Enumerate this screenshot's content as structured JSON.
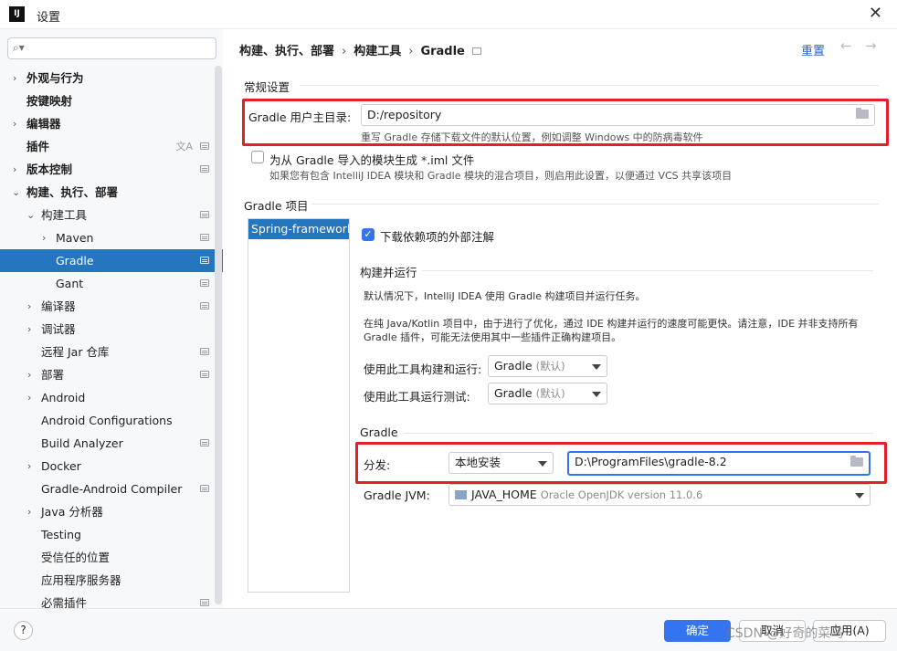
{
  "window": {
    "title": "设置",
    "app_icon": "IJ"
  },
  "search": {
    "placeholder": ""
  },
  "sidebar": {
    "items": [
      {
        "label": "外观与行为"
      },
      {
        "label": "按键映射"
      },
      {
        "label": "编辑器"
      },
      {
        "label": "插件"
      },
      {
        "label": "版本控制"
      },
      {
        "label": "构建、执行、部署"
      },
      {
        "label": "构建工具"
      },
      {
        "label": "Maven"
      },
      {
        "label": "Gradle"
      },
      {
        "label": "Gant"
      },
      {
        "label": "编译器"
      },
      {
        "label": "调试器"
      },
      {
        "label": "远程 Jar 仓库"
      },
      {
        "label": "部署"
      },
      {
        "label": "Android"
      },
      {
        "label": "Android Configurations"
      },
      {
        "label": "Build Analyzer"
      },
      {
        "label": "Docker"
      },
      {
        "label": "Gradle-Android Compiler"
      },
      {
        "label": "Java 分析器"
      },
      {
        "label": "Testing"
      },
      {
        "label": "受信任的位置"
      },
      {
        "label": "应用程序服务器"
      },
      {
        "label": "必需插件"
      }
    ],
    "selected": "Gradle"
  },
  "breadcrumb": {
    "part1": "构建、执行、部署",
    "part2": "构建工具",
    "part3": "Gradle",
    "sep": "›"
  },
  "header": {
    "reset": "重置",
    "back": "←",
    "forward": "→"
  },
  "general": {
    "title": "常规设置",
    "user_home_label": "Gradle 用户主目录:",
    "user_home_value": "D:/repository",
    "user_home_hint": "重写 Gradle 存储下载文件的默认位置，例如调整 Windows 中的防病毒软件",
    "iml_label": "为从 Gradle 导入的模块生成 *.iml 文件",
    "iml_hint": "如果您有包含 IntelliJ IDEA 模块和 Gradle 模块的混合项目，则启用此设置，以便通过 VCS 共享该项目"
  },
  "projects": {
    "title": "Gradle 项目",
    "list": [
      "Spring-framework"
    ],
    "download_annotations": "下载依赖项的外部注解",
    "build_run_title": "构建并运行",
    "desc1": "默认情况下，IntelliJ IDEA 使用 Gradle 构建项目并运行任务。",
    "desc2": "在纯 Java/Kotlin 项目中，由于进行了优化，通过 IDE 构建并运行的速度可能更快。请注意，IDE 并非支持所有",
    "desc3": "Gradle 插件，可能无法使用其中一些插件正确构建项目。",
    "build_with_label": "使用此工具构建和运行:",
    "build_with_value": "Gradle",
    "build_with_suffix": "(默认)",
    "test_with_label": "使用此工具运行测试:",
    "test_with_value": "Gradle",
    "test_with_suffix": "(默认)",
    "gradle_title": "Gradle",
    "dist_label": "分发:",
    "dist_value": "本地安装",
    "dist_path": "D:\\ProgramFiles\\gradle-8.2",
    "jvm_label": "Gradle JVM:",
    "jvm_value": "JAVA_HOME",
    "jvm_detail": "Oracle OpenJDK version 11.0.6"
  },
  "footer": {
    "help": "?",
    "ok": "确定",
    "cancel": "取消",
    "apply": "应用(A)",
    "watermark": "CSDN @好奇的菜鸟"
  },
  "colors": {
    "accent": "#3574f0",
    "selection": "#2675bf",
    "highlight_box": "#e0212b"
  }
}
